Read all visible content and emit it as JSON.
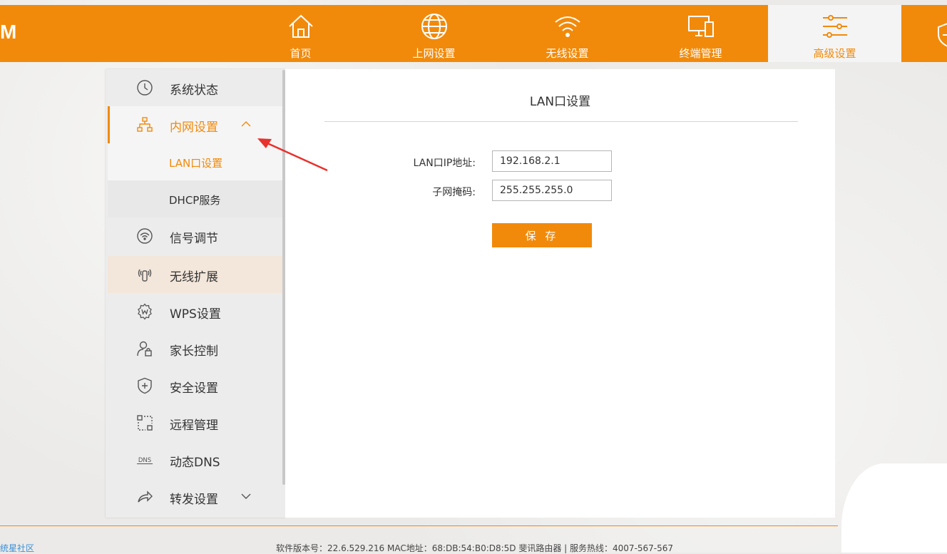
{
  "header": {
    "logo": "M",
    "nav": [
      {
        "label": "首页",
        "icon": "home-icon"
      },
      {
        "label": "上网设置",
        "icon": "globe-icon"
      },
      {
        "label": "无线设置",
        "icon": "wifi-icon"
      },
      {
        "label": "终端管理",
        "icon": "devices-icon"
      },
      {
        "label": "高级设置",
        "icon": "sliders-icon",
        "active": true
      }
    ],
    "extra_icon": "shield-plus-icon"
  },
  "sidebar": {
    "items": [
      {
        "label": "系统状态",
        "icon": "clock-icon"
      },
      {
        "label": "内网设置",
        "icon": "network-icon",
        "expanded": true,
        "children": [
          {
            "label": "LAN口设置",
            "active": true
          },
          {
            "label": "DHCP服务"
          }
        ]
      },
      {
        "label": "信号调节",
        "icon": "signal-icon"
      },
      {
        "label": "无线扩展",
        "icon": "antenna-icon"
      },
      {
        "label": "WPS设置",
        "icon": "wps-gear-icon"
      },
      {
        "label": "家长控制",
        "icon": "user-lock-icon"
      },
      {
        "label": "安全设置",
        "icon": "shield-icon"
      },
      {
        "label": "远程管理",
        "icon": "remote-icon"
      },
      {
        "label": "动态DNS",
        "icon": "dns-icon",
        "icon_text": "DNS"
      },
      {
        "label": "转发设置",
        "icon": "forward-icon"
      }
    ]
  },
  "panel": {
    "title": "LAN口设置",
    "fields": [
      {
        "label": "LAN口IP地址:",
        "value": "192.168.2.1"
      },
      {
        "label": "子网掩码:",
        "value": "255.255.255.0"
      }
    ],
    "save_label": "保 存"
  },
  "footer": {
    "left_link": "统星社区",
    "info": "软件版本号：22.6.529.216    MAC地址：68:DB:54:B0:D8:5D    斐讯路由器 | 服务热线：4007-567-567"
  },
  "colors": {
    "accent": "#f18a0b",
    "annotation_arrow": "#e8322d"
  }
}
